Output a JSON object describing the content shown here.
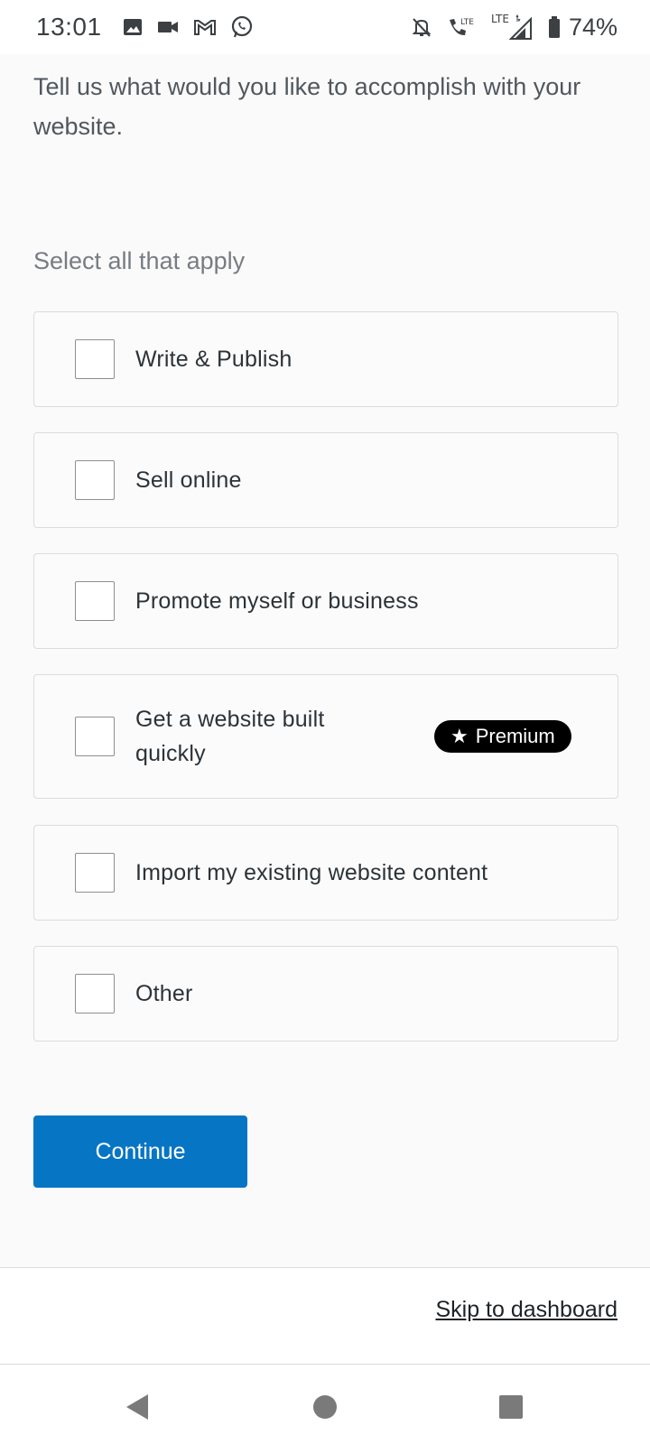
{
  "status_bar": {
    "time": "13:01",
    "left_icons": [
      "image-icon",
      "video-camera-icon",
      "gmail-icon",
      "whatsapp-icon"
    ],
    "right_icons": [
      "silent-bell-icon",
      "lte-call-icon",
      "lte-signal-icon",
      "battery-icon"
    ],
    "lte_label": "LTE",
    "battery": "74%"
  },
  "intro_text": "Tell us what would you like to accomplish with your website.",
  "select_label": "Select all that apply",
  "options": [
    {
      "label": "Write & Publish",
      "checked": false
    },
    {
      "label": "Sell online",
      "checked": false
    },
    {
      "label": "Promote myself or business",
      "checked": false
    },
    {
      "label": "Get a website built quickly",
      "checked": false,
      "badge": "Premium"
    },
    {
      "label": "Import my existing website content",
      "checked": false
    },
    {
      "label": "Other",
      "checked": false
    }
  ],
  "badge_star": "★",
  "continue_label": "Continue",
  "skip_label": "Skip to dashboard",
  "colors": {
    "primary_button": "#0675c4",
    "badge_bg": "#000000",
    "page_bg": "#fafafa"
  },
  "nav": [
    "back-icon",
    "home-icon",
    "recents-icon"
  ]
}
